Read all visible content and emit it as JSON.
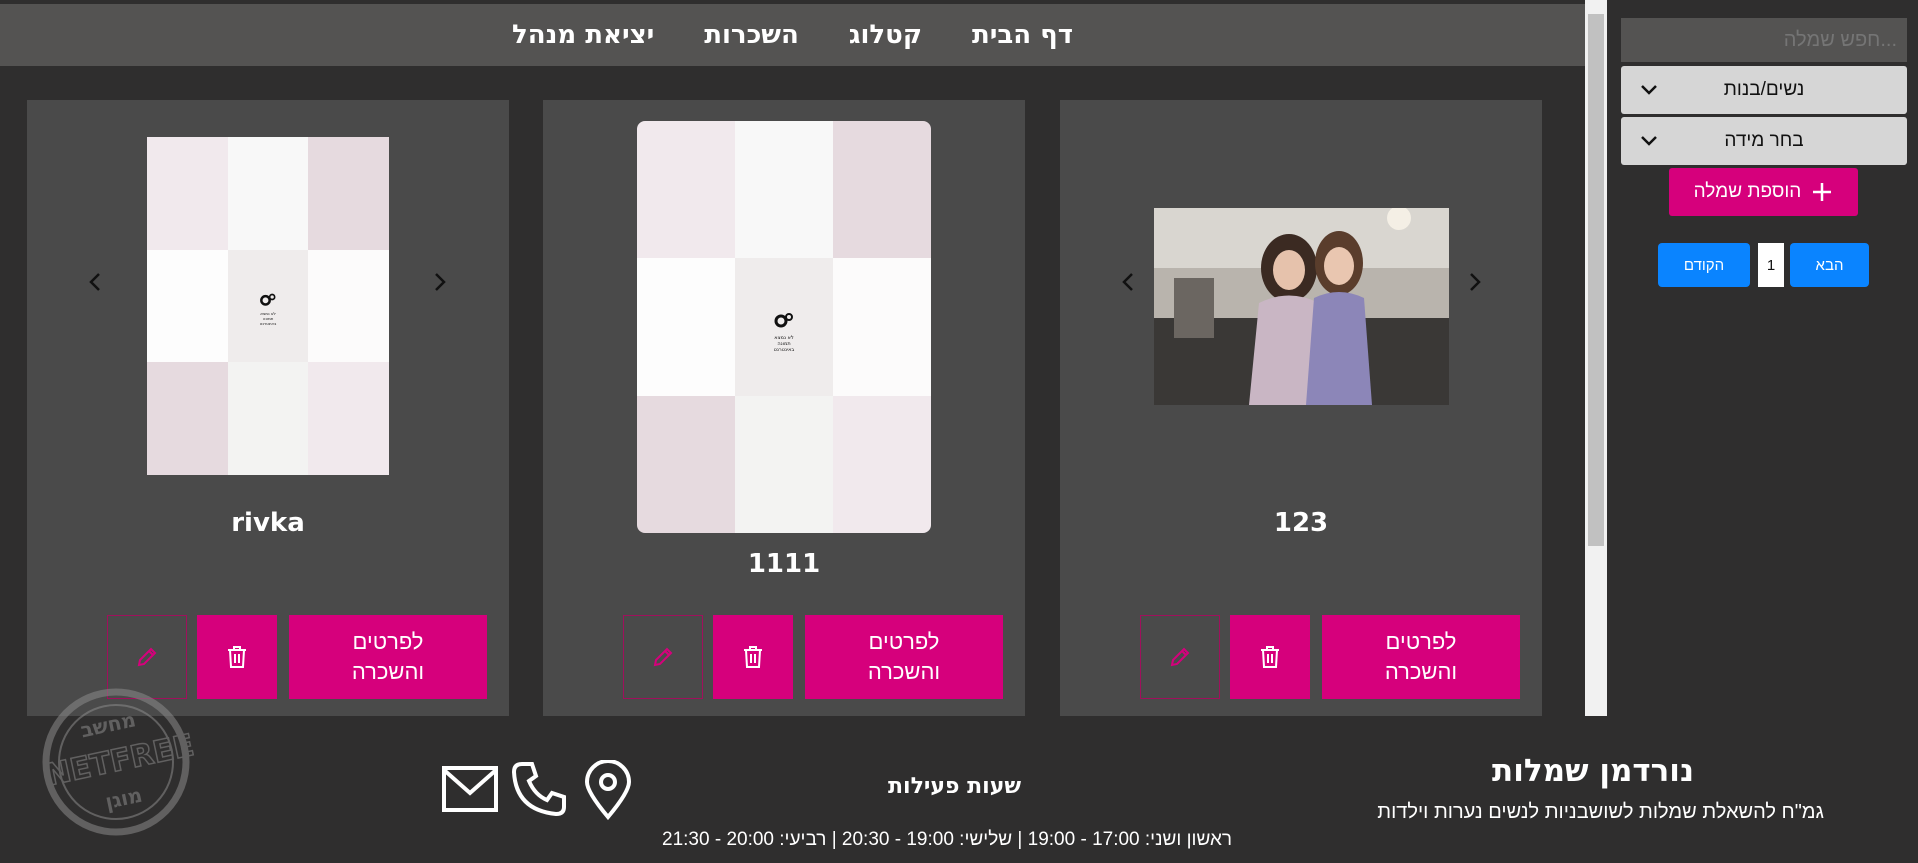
{
  "nav": {
    "home": "דף הבית",
    "catalog": "קטלוג",
    "rentals": "השכרות",
    "admin_exit": "יציאת מנהל"
  },
  "cards": [
    {
      "title": "123",
      "details_label": "לפרטים\nוהשכרה"
    },
    {
      "title": "1111",
      "details_label": "לפרטים\nוהשכרה"
    },
    {
      "title": "rivka",
      "details_label": "לפרטים\nוהשכרה"
    }
  ],
  "placeholder_caption": "לא נמצא\nתמונה\nבאינטרנט",
  "sidebar": {
    "search_placeholder": "חפש שמלה...",
    "gender_select": "נשים/בנות",
    "size_select": "בחר מידה",
    "add_dress": "הוספת שמלה",
    "pagination": {
      "next": "הבא",
      "page": "1",
      "prev": "הקודם"
    }
  },
  "footer": {
    "brand_title": "נורדמן שמלות",
    "brand_subtitle": "גמ\"ח להשאלת שמלות לשושבניות לנשים נערות וילדות",
    "hours_title": "שעות פעילות",
    "hours_text": "ראשון ושני: 17:00 - 19:00 | שלישי: 19:00 - 20:30 | רביעי: 20:00 - 21:30"
  },
  "stamp": {
    "top": "מחשב",
    "middle": "NETFREE",
    "bottom": "מוגן"
  },
  "colors": {
    "accent": "#d6007c",
    "nav_bg": "#545352",
    "card_bg": "#4a4a4a",
    "page_bg": "#2f2e2e",
    "pager_blue": "#0a84ff"
  },
  "icons": [
    "chevron-left-icon",
    "chevron-right-icon",
    "trash-icon",
    "pencil-icon",
    "chevron-down-icon",
    "plus-icon",
    "mail-icon",
    "phone-icon",
    "location-pin-icon"
  ]
}
